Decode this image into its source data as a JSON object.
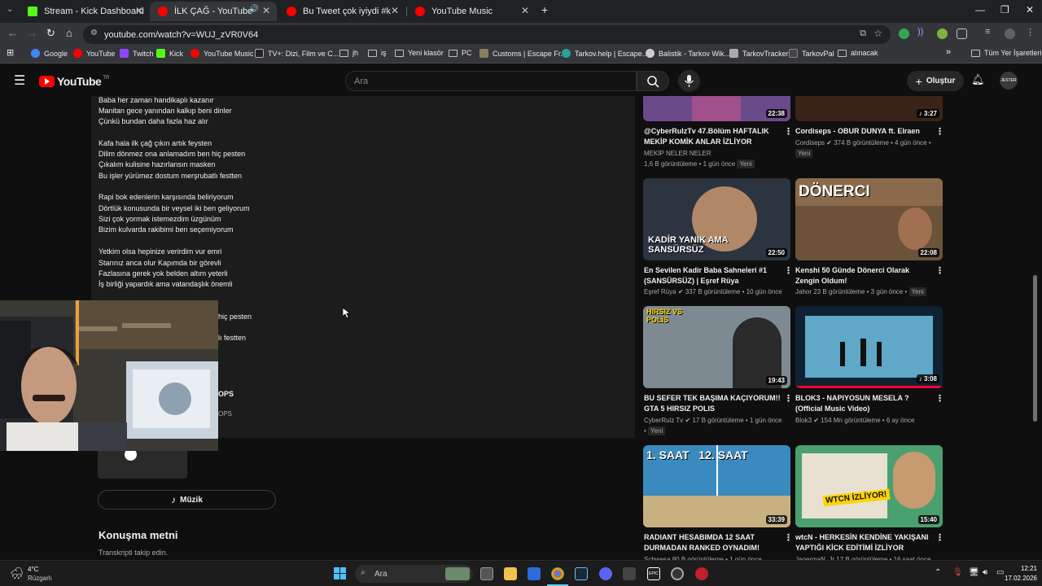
{
  "browser": {
    "tabs": [
      {
        "title": "Stream - Kick Dashboard",
        "favicon_color": "#53fc18"
      },
      {
        "title": "İLK ÇAĞ - YouTube",
        "favicon_color": "#ff0000"
      },
      {
        "title": "Bu Tweet çok iyiydi #keşfet #v",
        "favicon_color": "#ff0000"
      },
      {
        "title": "YouTube Music",
        "favicon_color": "#ff0000"
      }
    ],
    "new_tab": "+",
    "url": "youtube.com/watch?v=WUJ_zVR0V64",
    "bookmarks": [
      {
        "label": "Google",
        "type": "site",
        "color": "#4285f4"
      },
      {
        "label": "YouTube",
        "type": "site",
        "color": "#ff0000"
      },
      {
        "label": "Twitch",
        "type": "site",
        "color": "#9146ff"
      },
      {
        "label": "Kick",
        "type": "site",
        "color": "#53fc18"
      },
      {
        "label": "YouTube Music",
        "type": "site",
        "color": "#ff0000"
      },
      {
        "label": "TV+: Dizi, Film ve C...",
        "type": "site",
        "color": "#222222"
      },
      {
        "label": "jh",
        "type": "folder"
      },
      {
        "label": "iş",
        "type": "folder"
      },
      {
        "label": "Yeni klasör",
        "type": "folder"
      },
      {
        "label": "PC",
        "type": "folder"
      },
      {
        "label": "Customs | Escape Fr...",
        "type": "site",
        "color": "#8a7f5c"
      },
      {
        "label": "Tarkov.help | Escape...",
        "type": "site",
        "color": "#2aa198"
      },
      {
        "label": "Balistik - Tarkov Wik...",
        "type": "site",
        "color": "#cccccc"
      },
      {
        "label": "TarkovTracker",
        "type": "site",
        "color": "#aaaaaa"
      },
      {
        "label": "TarkovPal",
        "type": "site",
        "color": "#444444"
      },
      {
        "label": "alınacak",
        "type": "folder"
      }
    ],
    "all_bookmarks": "Tüm Yer İşaretleri"
  },
  "youtube": {
    "logo_text": "YouTube",
    "logo_region": "TR",
    "search_placeholder": "Ara",
    "create_label": "Oluştur",
    "avatar_text": "JESTER"
  },
  "lyrics": [
    "Baba her zaman handikaplı kazanır",
    "Manitan gece yanından kalkıp beni dinler",
    "Çünkü bundan daha fazla haz alır",
    "Kafa hala ilk çağ çıkın artık feysten",
    "Dilim dönmez ona anlamadım ben hiç pesten",
    "Çıkalım kulisine hazırlansın masken",
    "Bu işler yürümez dostum merşrubatlı festten",
    "Rapi bok edenlerin karşısında beliriyorum",
    "Dörtlük konusunda bir veysel iki ben geliyorum",
    "Sizi çok yormak istemezdim üzgünüm",
    "Bizim kulvarda rakibimi ben seçemiyorum",
    "Yetkim olsa hepinize verirdim vur emri",
    "Starınız anca olur Kapımda bir görevli",
    "Fazlasına gerek yok belden altım yeterli",
    "İş birliği yapardık ama vatandaşlık önemli",
    "hiç pesten",
    "lı festten",
    "OPS",
    "OPS"
  ],
  "music_label": "Müzik",
  "transcript": {
    "title": "Konuşma metni",
    "subtitle": "Transkripti takip edin."
  },
  "videos": [
    {
      "title": "@CyberRulzTv 47.Bölüm HAFTALIK MEKİP KOMİK ANLAR İZLİYOR",
      "channel": "MEKİP NELER NELER",
      "meta": "1,6 B görüntüleme • 1 gün önce",
      "badge": "Yeni",
      "duration": "22:38",
      "thumb_text": "",
      "thumb_color": "#6b4a8a"
    },
    {
      "title": "Cordiseps - OBUR DUNYA ft. Elraen",
      "channel": "Cordiseps",
      "meta": "374 B görüntüleme • 4 gün önce •",
      "badge": "Yeni",
      "duration": "3:27",
      "thumb_text": "",
      "thumb_color": "#3a2418"
    },
    {
      "title": "En Sevilen Kadir Baba Sahneleri #1 (SANSÜRSÜZ) | Eşref Rüya",
      "channel": "Eşref Rüya",
      "meta": "337 B görüntüleme • 10 gün önce",
      "badge": "",
      "duration": "22:50",
      "thumb_text": "KADİR YANIK AMA SANSÜRSÜZ",
      "thumb_color": "#2c3440"
    },
    {
      "title": "Kenshi 50 Günde Dönerci Olarak Zengin Oldum!",
      "channel": "Jahor",
      "meta": "23 B görüntüleme • 3 gün önce •",
      "badge": "Yeni",
      "duration": "22:08",
      "thumb_text": "DÖNERCI",
      "thumb_color": "#8a6a4a"
    },
    {
      "title": "BU SEFER TEK BAŞIMA KAÇIYORUM!! GTA 5 HIRSIZ POLIS",
      "channel": "CyberRulz Tv",
      "meta": "17 B görüntüleme • 1 gün önce",
      "badge": "Yeni",
      "duration": "19:43",
      "thumb_text": "HIRSIZ VS POLİS",
      "thumb_color": "#7d8a92"
    },
    {
      "title": "BLOK3 - NAPIYOSUN MESELA ? (Official Music Video)",
      "channel": "Blok3",
      "meta": "154 Mn görüntüleme • 6 ay önce",
      "badge": "",
      "duration": "3:08",
      "thumb_text": "",
      "thumb_color": "#1a3e5c"
    },
    {
      "title": "RADIANT HESABIMDA 12 SAAT DURMADAN RANKED OYNADIM!",
      "channel": "Schwesa",
      "meta": "80 B görüntüleme • 1 gün önce",
      "badge": "",
      "duration": "33:39",
      "thumb_text": "1. SAAT   12. SAAT",
      "thumb_color": "#3a8ac0"
    },
    {
      "title": "wtcN - HERKESİN KENDİNE YAKIŞANI YAPTIĞI KİCK EDİTİMİ İZLİYOR",
      "channel": "JagermaN_Jr",
      "meta": "12 B görüntüleme • 16 saat önce",
      "badge": "",
      "duration": "15:40",
      "thumb_text": "WTCN İZLİYOR!",
      "thumb_color": "#4aa070"
    }
  ],
  "taskbar": {
    "weather_temp": "4°C",
    "weather_desc": "Rüzgarlı",
    "search_label": "Ara",
    "time": "12:21",
    "date": "17.02.2026"
  }
}
